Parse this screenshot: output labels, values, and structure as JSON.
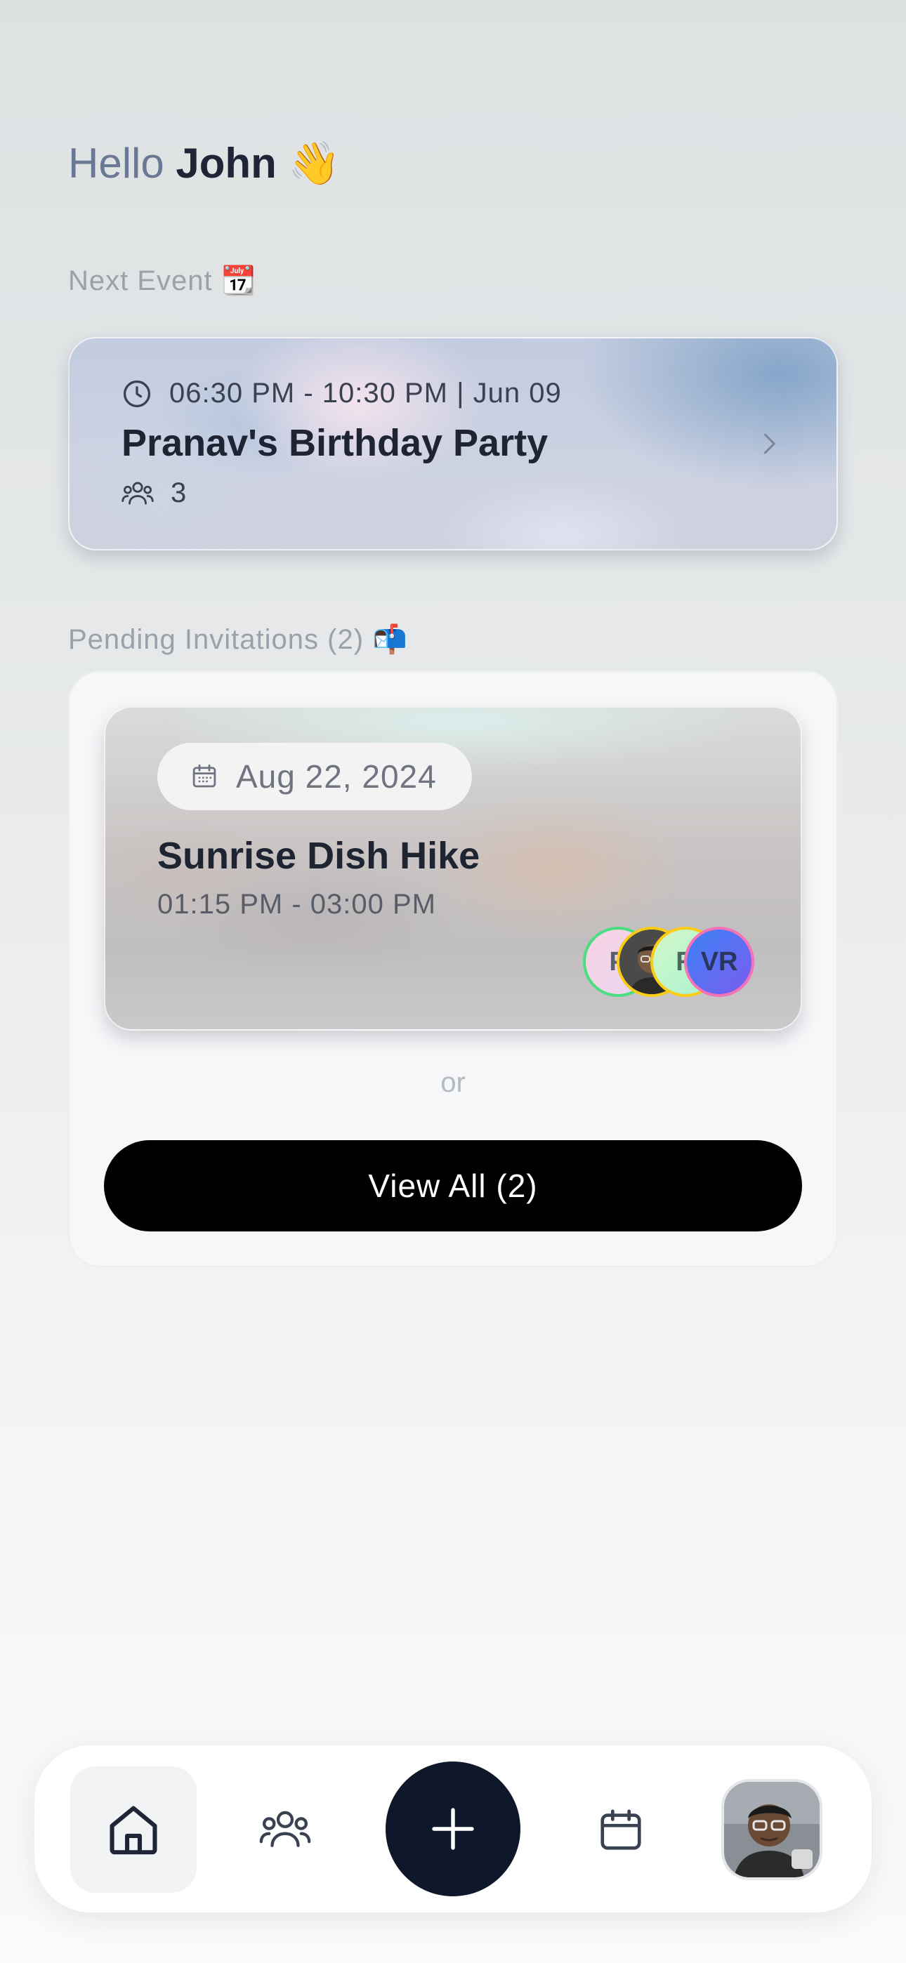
{
  "greeting": {
    "hello": "Hello",
    "name": "John",
    "emoji": "👋"
  },
  "next_event": {
    "section_label": "Next Event 📆",
    "time_line": "06:30 PM - 10:30 PM | Jun 09",
    "title": "Pranav's Birthday Party",
    "attendee_count": "3"
  },
  "pending": {
    "section_label": "Pending Invitations (2) 📬",
    "invite": {
      "date": "Aug 22, 2024",
      "title": "Sunrise Dish Hike",
      "time": "01:15 PM - 03:00 PM",
      "avatars": [
        {
          "initial": "P",
          "bg": "#f3cfe0",
          "border": "#4ade80",
          "color": "#5a6070"
        },
        {
          "initial": "",
          "bg": "#3a3a3a",
          "border": "#facc15",
          "color": "#ffffff"
        },
        {
          "initial": "R",
          "bg": "#bbf7d0",
          "border": "#facc15",
          "color": "#4a6a60"
        },
        {
          "initial": "VR",
          "bg": "#5b6ee8",
          "border": "#f472b6",
          "color": "#2a3560"
        }
      ]
    },
    "or_text": "or",
    "view_all_label": "View All (2)"
  },
  "nav": {
    "items": [
      "home-icon",
      "friends-icon",
      "plus-icon",
      "calendar-icon",
      "profile-avatar"
    ],
    "active": "home",
    "accent": "#0f172a"
  }
}
